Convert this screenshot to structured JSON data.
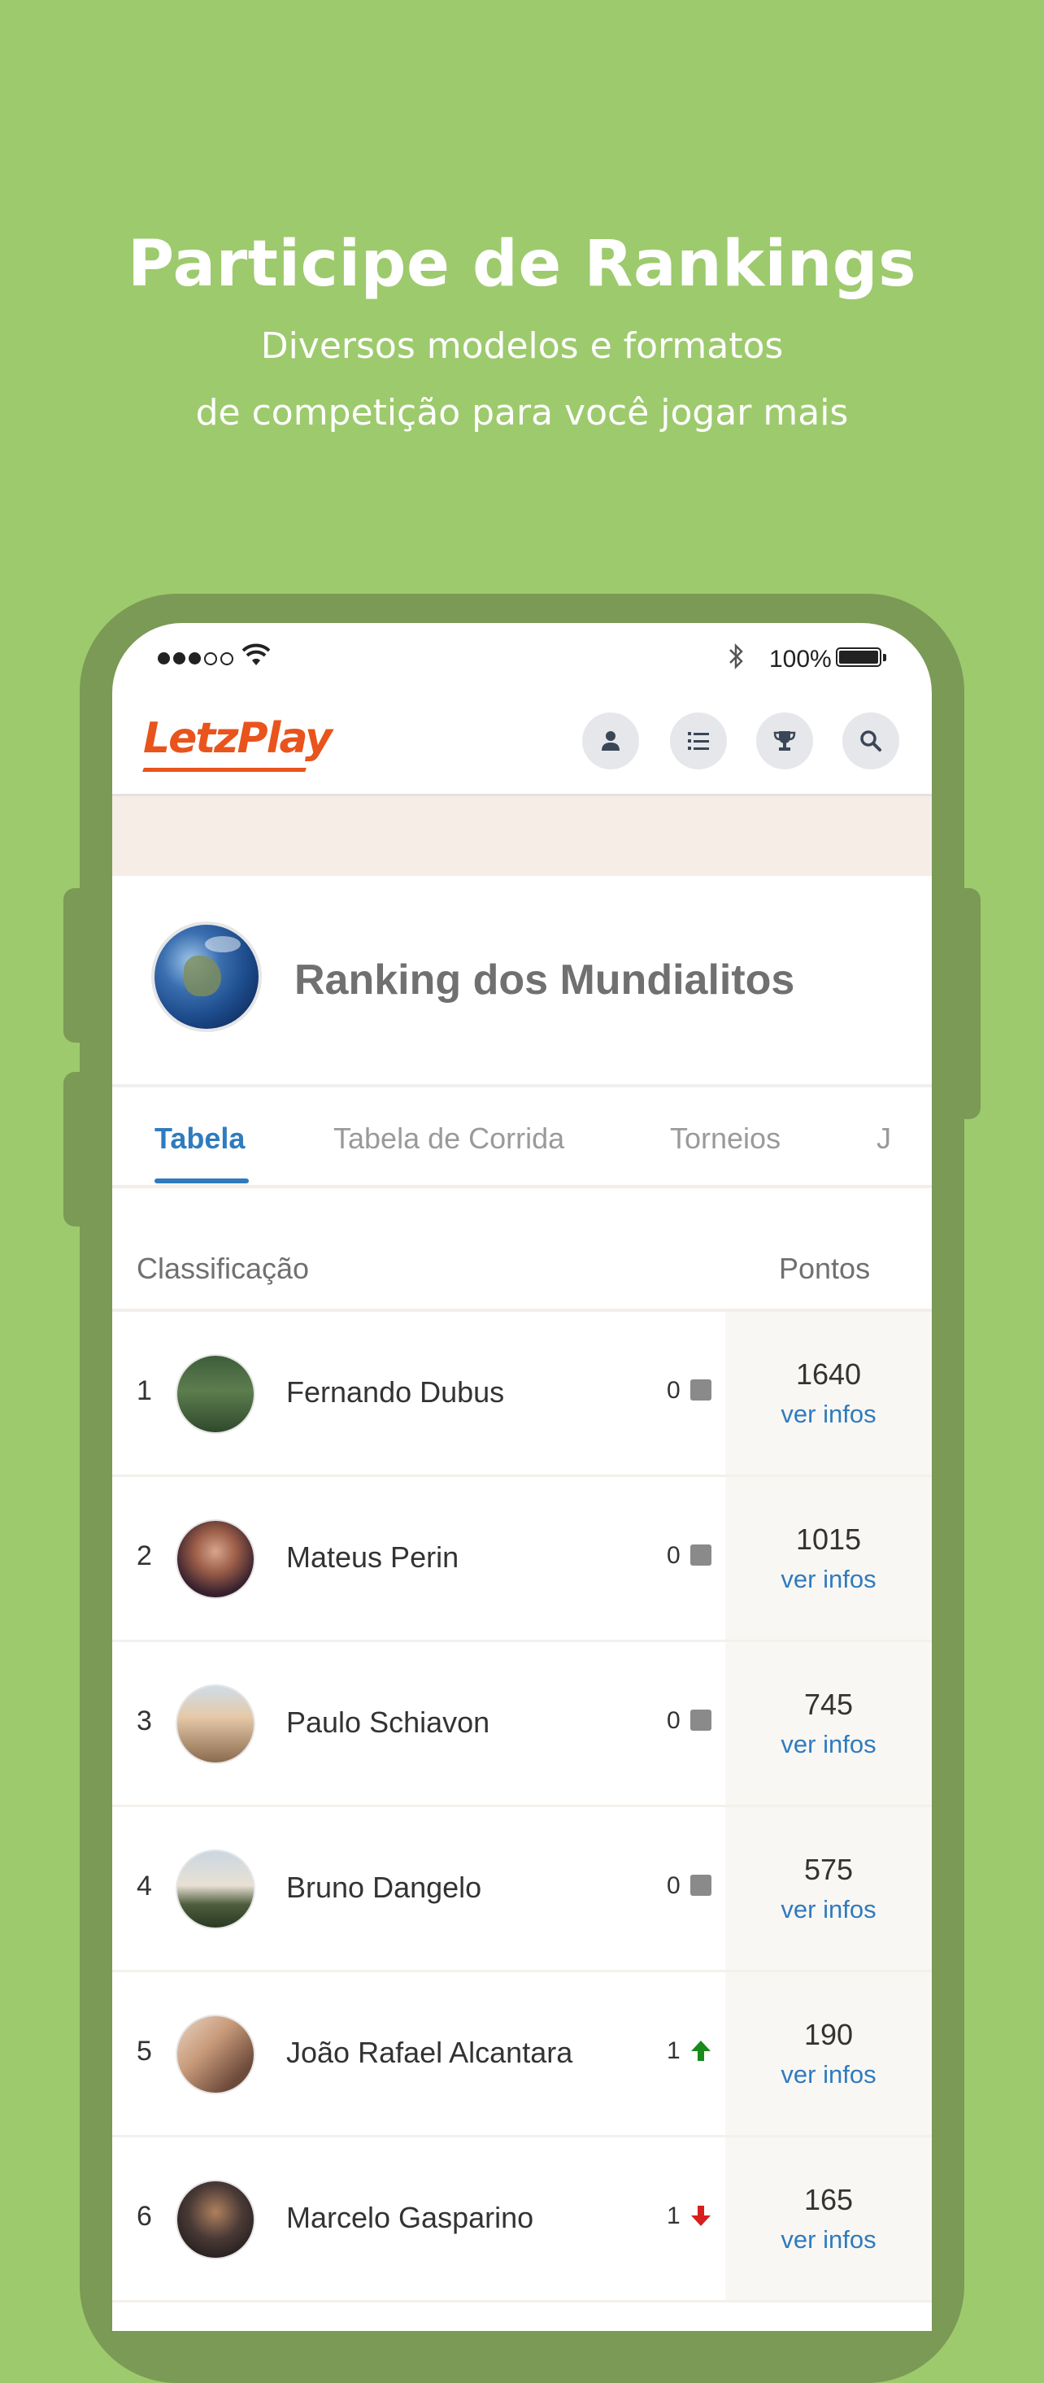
{
  "promo": {
    "headline": "Participe de Rankings",
    "subline1": "Diversos modelos e formatos",
    "subline2": "de competição para você jogar mais"
  },
  "status_bar": {
    "battery_percent": "100%"
  },
  "app_bar": {
    "logo": "LetzPlay",
    "nav_icons": [
      "user-icon",
      "list-icon",
      "trophy-icon",
      "search-icon"
    ]
  },
  "ranking": {
    "title": "Ranking dos Mundialitos"
  },
  "tabs": [
    {
      "label": "Tabela",
      "active": true
    },
    {
      "label": "Tabela de Corrida",
      "active": false
    },
    {
      "label": "Torneios",
      "active": false
    },
    {
      "label": "J",
      "active": false
    }
  ],
  "table": {
    "header_classification": "Classificação",
    "header_points": "Pontos",
    "rows": [
      {
        "rank": "1",
        "name": "Fernando Dubus",
        "movement": "0",
        "trend": "same",
        "points": "1640",
        "link": "ver infos"
      },
      {
        "rank": "2",
        "name": "Mateus Perin",
        "movement": "0",
        "trend": "same",
        "points": "1015",
        "link": "ver infos"
      },
      {
        "rank": "3",
        "name": "Paulo Schiavon",
        "movement": "0",
        "trend": "same",
        "points": "745",
        "link": "ver infos"
      },
      {
        "rank": "4",
        "name": "Bruno Dangelo",
        "movement": "0",
        "trend": "same",
        "points": "575",
        "link": "ver infos"
      },
      {
        "rank": "5",
        "name": "João Rafael Alcantara",
        "movement": "1",
        "trend": "up",
        "points": "190",
        "link": "ver infos"
      },
      {
        "rank": "6",
        "name": "Marcelo Gasparino",
        "movement": "1",
        "trend": "down",
        "points": "165",
        "link": "ver infos"
      }
    ]
  },
  "colors": {
    "background": "#9dca6d",
    "accent_blue": "#2f7bbf",
    "logo_orange": "#e8541c",
    "trend_up": "#1a8a1a",
    "trend_down": "#d81e1e"
  }
}
